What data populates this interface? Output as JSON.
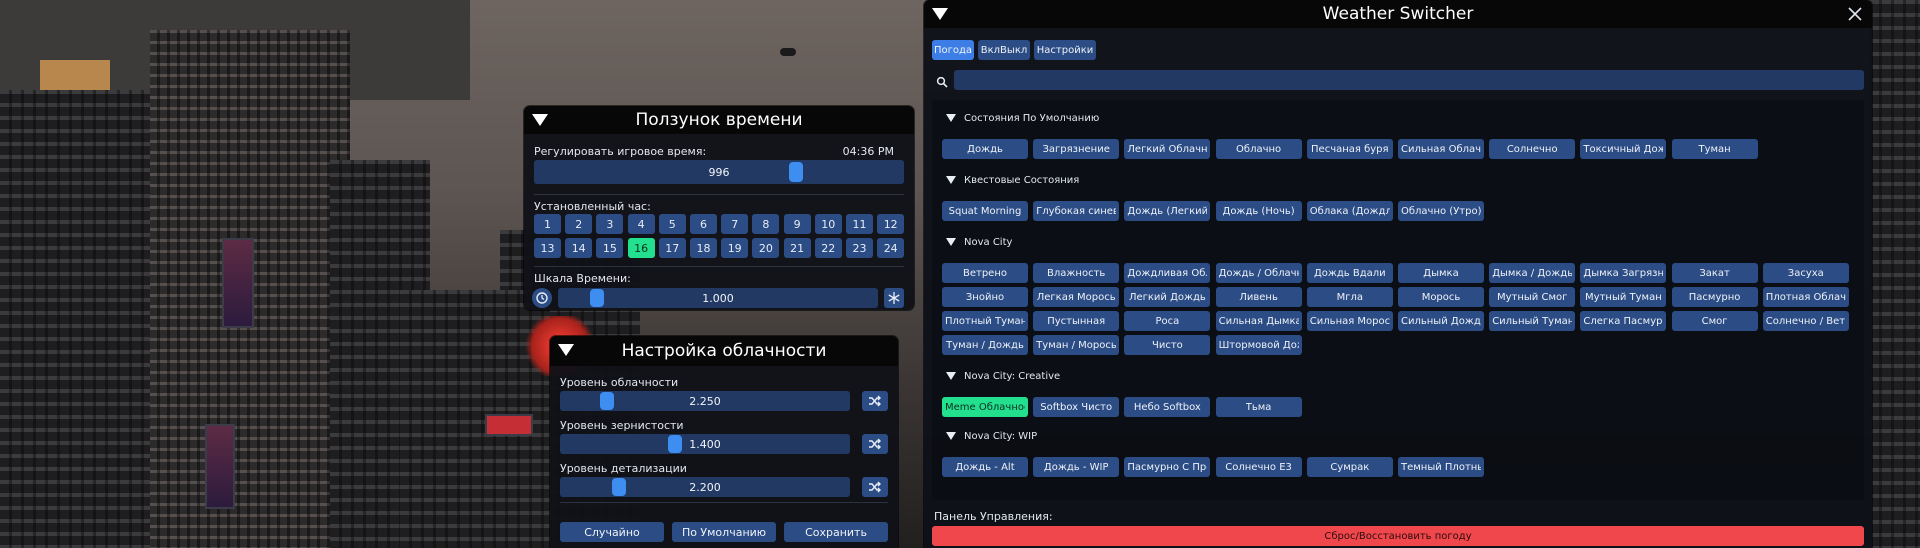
{
  "time_slider_window": {
    "title": "Ползунок времени",
    "adjust_label": "Регулировать игровое время:",
    "clock": "04:36 PM",
    "time_value": "996",
    "time_fraction": 0.5,
    "hour_label": "Установленный час:",
    "hours_row1": [
      "1",
      "2",
      "3",
      "4",
      "5",
      "6",
      "7",
      "8",
      "9",
      "10",
      "11",
      "12"
    ],
    "hours_row2": [
      "13",
      "14",
      "15",
      "16",
      "17",
      "18",
      "19",
      "20",
      "21",
      "22",
      "23",
      "24"
    ],
    "selected_hour": "16",
    "scale_label": "Шкала Времени:",
    "scale_value": "1.000"
  },
  "cloud_window": {
    "title": "Настройка облачности",
    "sliders": [
      {
        "label": "Уровень облачности",
        "value": "2.250"
      },
      {
        "label": "Уровень зернистости",
        "value": "1.400"
      },
      {
        "label": "Уровень детализации",
        "value": "2.200"
      }
    ],
    "buttons": {
      "random": "Случайно",
      "default": "По Умолчанию",
      "save": "Сохранить"
    }
  },
  "weather_window": {
    "title": "Weather Switcher",
    "tabs": [
      "Погода",
      "ВклВыкл",
      "Настройки"
    ],
    "active_tab": "Погода",
    "search_value": "",
    "sections": [
      {
        "title": "Состояния По Умолчанию",
        "items": [
          "Дождь",
          "Загрязнение",
          "Легкий Облачность",
          "Облачно",
          "Песчаная буря",
          "Сильная Облачность",
          "Солнечно",
          "Токсичный Дождь",
          "Туман"
        ]
      },
      {
        "title": "Квестовые Состояния",
        "items": [
          "Squat Morning",
          "Глубокая синева",
          "Дождь (Легкий)",
          "Дождь (Ночь)",
          "Облака (Дождливые)",
          "Облачно (Утро)"
        ]
      },
      {
        "title": "Nova City",
        "items": [
          "Ветрено",
          "Влажность",
          "Дождливая Облачность",
          "Дождь / Облачно",
          "Дождь Вдали",
          "Дымка",
          "Дымка / Дождь",
          "Дымка Загрязнение",
          "Закат",
          "Засуха",
          "Знойно",
          "Легкая Морось",
          "Легкий Дождь",
          "Ливень",
          "Мгла",
          "Морось",
          "Мутный Смог",
          "Мутный Туман",
          "Пасмурно",
          "Плотная Облачность",
          "Плотный Туман",
          "Пустынная",
          "Роса",
          "Сильная Дымка",
          "Сильная Морось",
          "Сильный Дождь",
          "Сильный Туман",
          "Слегка Пасмурно",
          "Смог",
          "Солнечно / Ветрено",
          "Туман / Дождь",
          "Туман / Морось",
          "Чисто",
          "Штормовой Дождь"
        ]
      },
      {
        "title": "Nova City: Creative",
        "items": [
          "Meme Облачность",
          "Softbox Чисто",
          "Небо Softbox",
          "Тьма"
        ]
      },
      {
        "title": "Nova City: WIP",
        "items": [
          "Дождь - Alt",
          "Дождь - WIP",
          "Пасмурно С Прояснениями",
          "Солнечно E3",
          "Сумрак",
          "Темный Плотный"
        ]
      }
    ],
    "selected_item": "Meme Облачность",
    "control_panel_label": "Панель Управления:",
    "reset_button": "Сброс/Восстановить погоду"
  },
  "icons": {
    "collapse": "triangle-down-icon",
    "random": "shuffle-icon",
    "reset_time": "history-icon",
    "freeze": "snowflake-icon",
    "search": "search-icon",
    "close": "close-icon"
  },
  "colors": {
    "button": "#2b4c84",
    "active_tab": "#3d7ee6",
    "selected": "#22e08d",
    "slider_knob": "#3d8ef0",
    "reset": "#f0474c"
  }
}
